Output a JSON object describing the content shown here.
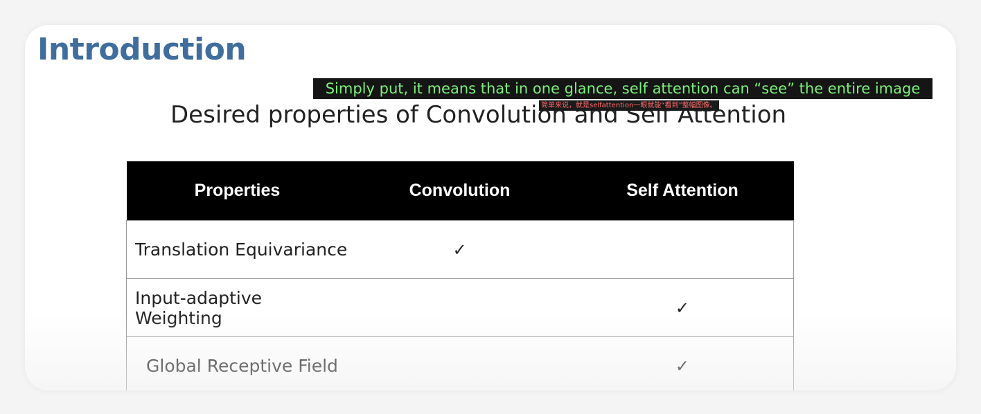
{
  "slide": {
    "title": "Introduction",
    "heading": "Desired properties of Convolution and Self Attention"
  },
  "captions": {
    "english": "Simply put, it means that in one glance, self attention can “see” the entire image",
    "chinese": "简单来说，就是selfattention一眼就能“看到”整幅图像。"
  },
  "table": {
    "headers": [
      "Properties",
      "Convolution",
      "Self Attention"
    ],
    "rows": [
      {
        "property": "Translation Equivariance",
        "convolution": "✓",
        "self_attention": ""
      },
      {
        "property": "Input-adaptive Weighting",
        "convolution": "",
        "self_attention": "✓"
      },
      {
        "property": "Global Receptive Field",
        "convolution": "",
        "self_attention": "✓"
      }
    ]
  },
  "colors": {
    "title": "#3f6e9e",
    "caption_english": "#7df07a",
    "caption_chinese": "#ff6b6b",
    "table_header_bg": "#000000"
  },
  "icons": {
    "check": "checkmark-icon"
  }
}
